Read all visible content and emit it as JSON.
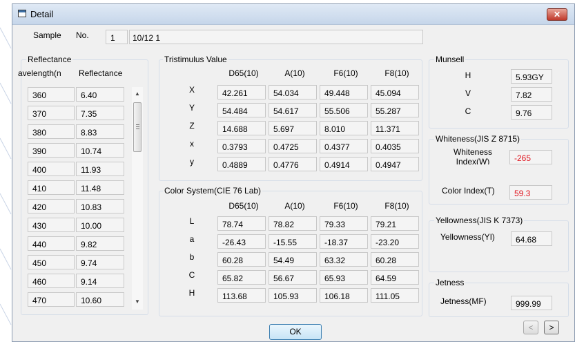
{
  "window": {
    "title": "Detail",
    "close_glyph": "✕"
  },
  "sample": {
    "label": "Sample",
    "no_label": "No.",
    "no_value": "1",
    "name_value": "10/12 1"
  },
  "reflectance": {
    "title": "Reflectance",
    "col_wavelength": "avelength(n",
    "col_reflectance": "Reflectance",
    "rows": [
      {
        "wl": "360",
        "val": "6.40"
      },
      {
        "wl": "370",
        "val": "7.35"
      },
      {
        "wl": "380",
        "val": "8.83"
      },
      {
        "wl": "390",
        "val": "10.74"
      },
      {
        "wl": "400",
        "val": "11.93"
      },
      {
        "wl": "410",
        "val": "11.48"
      },
      {
        "wl": "420",
        "val": "10.83"
      },
      {
        "wl": "430",
        "val": "10.00"
      },
      {
        "wl": "440",
        "val": "9.82"
      },
      {
        "wl": "450",
        "val": "9.74"
      },
      {
        "wl": "460",
        "val": "9.14"
      },
      {
        "wl": "470",
        "val": "10.60"
      }
    ]
  },
  "tristimulus": {
    "title": "Tristimulus Value",
    "columns": [
      "D65(10)",
      "A(10)",
      "F6(10)",
      "F8(10)"
    ],
    "rows": [
      {
        "label": "X",
        "values": [
          "42.261",
          "54.034",
          "49.448",
          "45.094"
        ]
      },
      {
        "label": "Y",
        "values": [
          "54.484",
          "54.617",
          "55.506",
          "55.287"
        ]
      },
      {
        "label": "Z",
        "values": [
          "14.688",
          "5.697",
          "8.010",
          "11.371"
        ]
      },
      {
        "label": "x",
        "values": [
          "0.3793",
          "0.4725",
          "0.4377",
          "0.4035"
        ]
      },
      {
        "label": "y",
        "values": [
          "0.4889",
          "0.4776",
          "0.4914",
          "0.4947"
        ]
      }
    ]
  },
  "color_system": {
    "title": "Color System(CIE 76 Lab)",
    "columns": [
      "D65(10)",
      "A(10)",
      "F6(10)",
      "F8(10)"
    ],
    "rows": [
      {
        "label": "L",
        "values": [
          "78.74",
          "78.82",
          "79.33",
          "79.21"
        ]
      },
      {
        "label": "a",
        "values": [
          "-26.43",
          "-15.55",
          "-18.37",
          "-23.20"
        ]
      },
      {
        "label": "b",
        "values": [
          "60.28",
          "54.49",
          "63.32",
          "60.28"
        ]
      },
      {
        "label": "C",
        "values": [
          "65.82",
          "56.67",
          "65.93",
          "64.59"
        ]
      },
      {
        "label": "H",
        "values": [
          "113.68",
          "105.93",
          "106.18",
          "111.05"
        ]
      }
    ]
  },
  "munsell": {
    "title": "Munsell",
    "rows": [
      {
        "label": "H",
        "value": "5.93GY"
      },
      {
        "label": "V",
        "value": "7.82"
      },
      {
        "label": "C",
        "value": "9.76"
      }
    ]
  },
  "whiteness": {
    "title": "Whiteness(JIS Z 8715)",
    "label_line1": "Whiteness",
    "label_line2": "Index(W)",
    "value": "-265",
    "color_index_label": "Color Index(T)",
    "color_index_value": "59.3"
  },
  "yellowness": {
    "title": "Yellowness(JIS K 7373)",
    "label": "Yellowness(YI)",
    "value": "64.68"
  },
  "jetness": {
    "title": "Jetness",
    "label": "Jetness(MF)",
    "value": "999.99"
  },
  "buttons": {
    "ok": "OK",
    "prev": "<",
    "next": ">"
  },
  "colors": {
    "value_red": "#e0141e"
  }
}
